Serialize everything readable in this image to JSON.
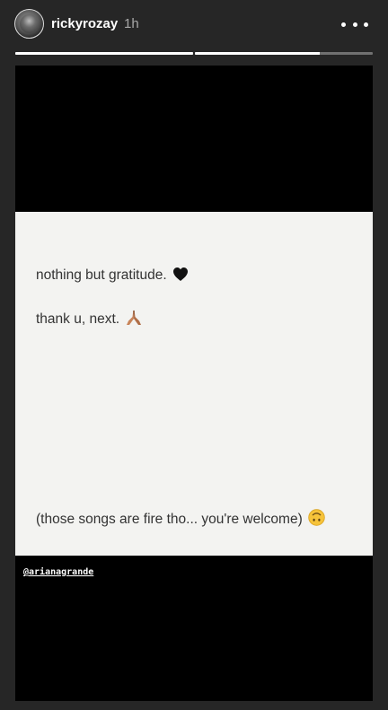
{
  "header": {
    "username": "rickyrozay",
    "time": "1h",
    "avatar_icon": "avatar-icon",
    "more_icon": "more-horizontal-icon"
  },
  "progress": {
    "segments": [
      {
        "fill": 1.0
      },
      {
        "fill": 0.7
      }
    ]
  },
  "story": {
    "note_lines": [
      {
        "text": "nothing but gratitude.",
        "emoji": "black-heart-icon"
      },
      {
        "text": "thank u, next.",
        "emoji": "folded-hands-icon"
      },
      {
        "text": "(those songs are fire tho... you're welcome)",
        "emoji": "upside-down-face-icon"
      }
    ],
    "mention": "@arianagrande"
  },
  "colors": {
    "background": "#262626",
    "media_background": "#000000",
    "card_background": "#f3f3f1",
    "text": "#333333"
  }
}
